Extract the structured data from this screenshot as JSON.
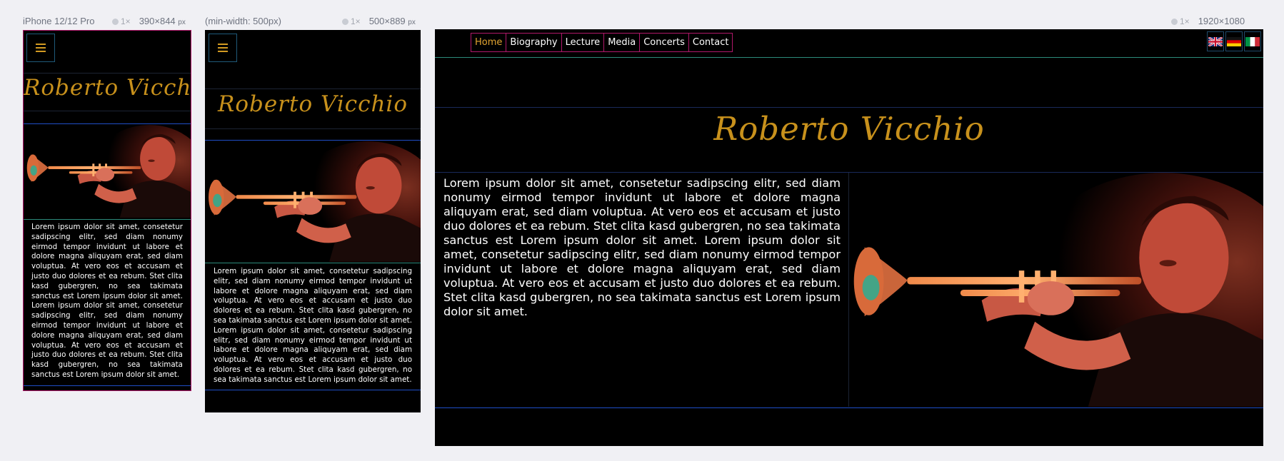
{
  "viewports": [
    {
      "name": "iPhone 12/12 Pro",
      "scale": "1×",
      "size": "390×844",
      "unit": "px"
    },
    {
      "name": "(min-width: 500px)",
      "scale": "1×",
      "size": "500×889",
      "unit": "px"
    },
    {
      "name": "",
      "scale": "1×",
      "size": "1920×1080",
      "unit": ""
    }
  ],
  "site": {
    "signature": "Roberto Vicchio",
    "nav": [
      "Home",
      "Biography",
      "Lecture",
      "Media",
      "Concerts",
      "Contact"
    ],
    "active_nav": "Home",
    "languages": [
      "english-flag",
      "german-flag",
      "italian-flag"
    ],
    "body_text": "Lorem ipsum dolor sit amet, consetetur sadipscing elitr, sed diam nonumy eirmod tempor invidunt ut labore et dolore magna aliquyam erat, sed diam voluptua. At vero eos et accusam et justo duo dolores et ea rebum. Stet clita kasd gubergren, no sea takimata sanctus est Lorem ipsum dolor sit amet. Lorem ipsum dolor sit amet, consetetur sadipscing elitr, sed diam nonumy eirmod tempor invidunt ut labore et dolore magna aliquyam erat, sed diam voluptua. At vero eos et accusam et justo duo dolores et ea rebum. Stet clita kasd gubergren, no sea takimata sanctus est Lorem ipsum dolor sit amet."
  },
  "colors": {
    "page_bg": "#f0f0f4",
    "site_bg": "#000000",
    "accent_gold": "#e2a431",
    "nav_border": "#b0186a",
    "divider_blue": "#1f4ec7",
    "divider_teal": "#2c8a7a"
  }
}
